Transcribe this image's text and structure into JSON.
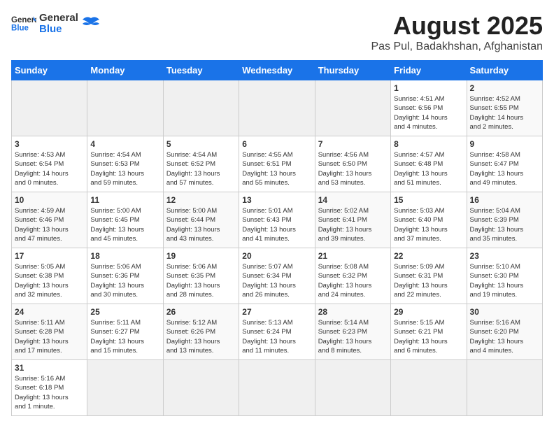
{
  "header": {
    "logo_general": "General",
    "logo_blue": "Blue",
    "title": "August 2025",
    "subtitle": "Pas Pul, Badakhshan, Afghanistan"
  },
  "weekdays": [
    "Sunday",
    "Monday",
    "Tuesday",
    "Wednesday",
    "Thursday",
    "Friday",
    "Saturday"
  ],
  "weeks": [
    [
      {
        "day": "",
        "info": ""
      },
      {
        "day": "",
        "info": ""
      },
      {
        "day": "",
        "info": ""
      },
      {
        "day": "",
        "info": ""
      },
      {
        "day": "",
        "info": ""
      },
      {
        "day": "1",
        "info": "Sunrise: 4:51 AM\nSunset: 6:56 PM\nDaylight: 14 hours\nand 4 minutes."
      },
      {
        "day": "2",
        "info": "Sunrise: 4:52 AM\nSunset: 6:55 PM\nDaylight: 14 hours\nand 2 minutes."
      }
    ],
    [
      {
        "day": "3",
        "info": "Sunrise: 4:53 AM\nSunset: 6:54 PM\nDaylight: 14 hours\nand 0 minutes."
      },
      {
        "day": "4",
        "info": "Sunrise: 4:54 AM\nSunset: 6:53 PM\nDaylight: 13 hours\nand 59 minutes."
      },
      {
        "day": "5",
        "info": "Sunrise: 4:54 AM\nSunset: 6:52 PM\nDaylight: 13 hours\nand 57 minutes."
      },
      {
        "day": "6",
        "info": "Sunrise: 4:55 AM\nSunset: 6:51 PM\nDaylight: 13 hours\nand 55 minutes."
      },
      {
        "day": "7",
        "info": "Sunrise: 4:56 AM\nSunset: 6:50 PM\nDaylight: 13 hours\nand 53 minutes."
      },
      {
        "day": "8",
        "info": "Sunrise: 4:57 AM\nSunset: 6:48 PM\nDaylight: 13 hours\nand 51 minutes."
      },
      {
        "day": "9",
        "info": "Sunrise: 4:58 AM\nSunset: 6:47 PM\nDaylight: 13 hours\nand 49 minutes."
      }
    ],
    [
      {
        "day": "10",
        "info": "Sunrise: 4:59 AM\nSunset: 6:46 PM\nDaylight: 13 hours\nand 47 minutes."
      },
      {
        "day": "11",
        "info": "Sunrise: 5:00 AM\nSunset: 6:45 PM\nDaylight: 13 hours\nand 45 minutes."
      },
      {
        "day": "12",
        "info": "Sunrise: 5:00 AM\nSunset: 6:44 PM\nDaylight: 13 hours\nand 43 minutes."
      },
      {
        "day": "13",
        "info": "Sunrise: 5:01 AM\nSunset: 6:43 PM\nDaylight: 13 hours\nand 41 minutes."
      },
      {
        "day": "14",
        "info": "Sunrise: 5:02 AM\nSunset: 6:41 PM\nDaylight: 13 hours\nand 39 minutes."
      },
      {
        "day": "15",
        "info": "Sunrise: 5:03 AM\nSunset: 6:40 PM\nDaylight: 13 hours\nand 37 minutes."
      },
      {
        "day": "16",
        "info": "Sunrise: 5:04 AM\nSunset: 6:39 PM\nDaylight: 13 hours\nand 35 minutes."
      }
    ],
    [
      {
        "day": "17",
        "info": "Sunrise: 5:05 AM\nSunset: 6:38 PM\nDaylight: 13 hours\nand 32 minutes."
      },
      {
        "day": "18",
        "info": "Sunrise: 5:06 AM\nSunset: 6:36 PM\nDaylight: 13 hours\nand 30 minutes."
      },
      {
        "day": "19",
        "info": "Sunrise: 5:06 AM\nSunset: 6:35 PM\nDaylight: 13 hours\nand 28 minutes."
      },
      {
        "day": "20",
        "info": "Sunrise: 5:07 AM\nSunset: 6:34 PM\nDaylight: 13 hours\nand 26 minutes."
      },
      {
        "day": "21",
        "info": "Sunrise: 5:08 AM\nSunset: 6:32 PM\nDaylight: 13 hours\nand 24 minutes."
      },
      {
        "day": "22",
        "info": "Sunrise: 5:09 AM\nSunset: 6:31 PM\nDaylight: 13 hours\nand 22 minutes."
      },
      {
        "day": "23",
        "info": "Sunrise: 5:10 AM\nSunset: 6:30 PM\nDaylight: 13 hours\nand 19 minutes."
      }
    ],
    [
      {
        "day": "24",
        "info": "Sunrise: 5:11 AM\nSunset: 6:28 PM\nDaylight: 13 hours\nand 17 minutes."
      },
      {
        "day": "25",
        "info": "Sunrise: 5:11 AM\nSunset: 6:27 PM\nDaylight: 13 hours\nand 15 minutes."
      },
      {
        "day": "26",
        "info": "Sunrise: 5:12 AM\nSunset: 6:26 PM\nDaylight: 13 hours\nand 13 minutes."
      },
      {
        "day": "27",
        "info": "Sunrise: 5:13 AM\nSunset: 6:24 PM\nDaylight: 13 hours\nand 11 minutes."
      },
      {
        "day": "28",
        "info": "Sunrise: 5:14 AM\nSunset: 6:23 PM\nDaylight: 13 hours\nand 8 minutes."
      },
      {
        "day": "29",
        "info": "Sunrise: 5:15 AM\nSunset: 6:21 PM\nDaylight: 13 hours\nand 6 minutes."
      },
      {
        "day": "30",
        "info": "Sunrise: 5:16 AM\nSunset: 6:20 PM\nDaylight: 13 hours\nand 4 minutes."
      }
    ],
    [
      {
        "day": "31",
        "info": "Sunrise: 5:16 AM\nSunset: 6:18 PM\nDaylight: 13 hours\nand 1 minute."
      },
      {
        "day": "",
        "info": ""
      },
      {
        "day": "",
        "info": ""
      },
      {
        "day": "",
        "info": ""
      },
      {
        "day": "",
        "info": ""
      },
      {
        "day": "",
        "info": ""
      },
      {
        "day": "",
        "info": ""
      }
    ]
  ]
}
